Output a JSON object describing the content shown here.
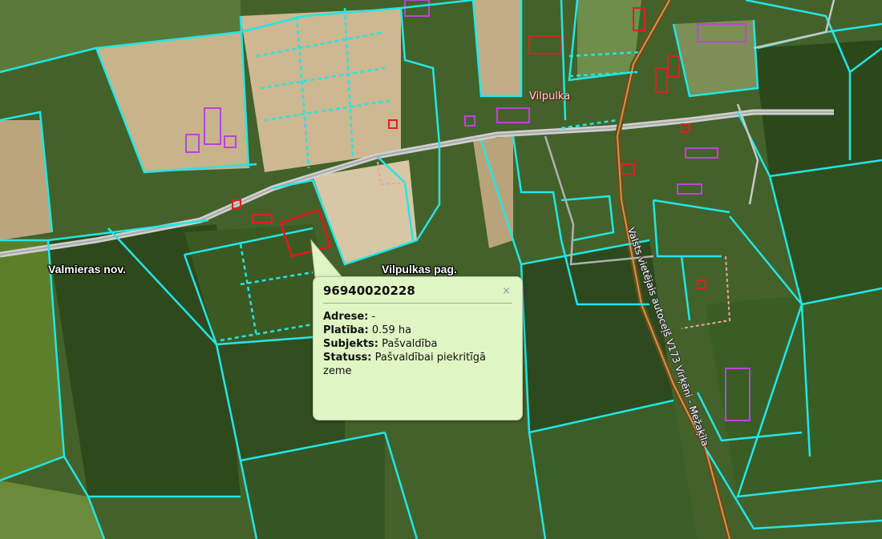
{
  "map": {
    "labels": {
      "municipality": "Valmieras nov.",
      "parish": "Vilpulkas pag.",
      "village": "Vilpulka",
      "road": "Valsts vietējais autoceļš V173 Virķēni - Mežaķīla"
    },
    "colors": {
      "parcel_boundary": "#22e6e8",
      "selected_parcel": "#e8141c",
      "building_outline": "#c040e0",
      "building_red": "#e02020",
      "road": "#c8c8c8",
      "popup_background": "#dff5c4"
    }
  },
  "popup": {
    "parcel_id": "96940020228",
    "close_icon": "×",
    "fields": [
      {
        "label": "Adrese:",
        "value": "-"
      },
      {
        "label": "Platība:",
        "value": "0.59 ha"
      },
      {
        "label": "Subjekts:",
        "value": "Pašvaldība"
      },
      {
        "label": "Statuss:",
        "value": "Pašvaldībai piekritīgā zeme"
      }
    ]
  }
}
